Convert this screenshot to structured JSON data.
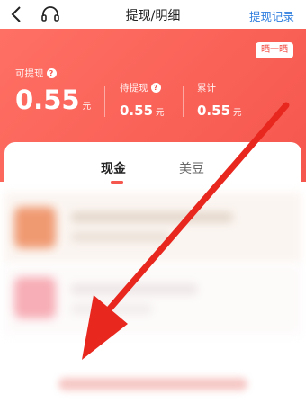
{
  "navbar": {
    "title": "提现/明细",
    "records_label": "提现记录",
    "back_icon": "chevron-left-icon",
    "service_icon": "headset-icon"
  },
  "header": {
    "share_label": "晒一晒",
    "available": {
      "label": "可提现",
      "amount": "0.55",
      "unit": "元"
    },
    "pending": {
      "label": "待提现",
      "amount": "0.55",
      "unit": "元"
    },
    "total": {
      "label": "累计",
      "amount": "0.55",
      "unit": "元"
    }
  },
  "tabs": [
    {
      "label": "现金",
      "active": true
    },
    {
      "label": "美豆",
      "active": false
    }
  ],
  "colors": {
    "accent": "#f5564d",
    "link": "#2e7dde",
    "arrow": "#e8271f"
  }
}
